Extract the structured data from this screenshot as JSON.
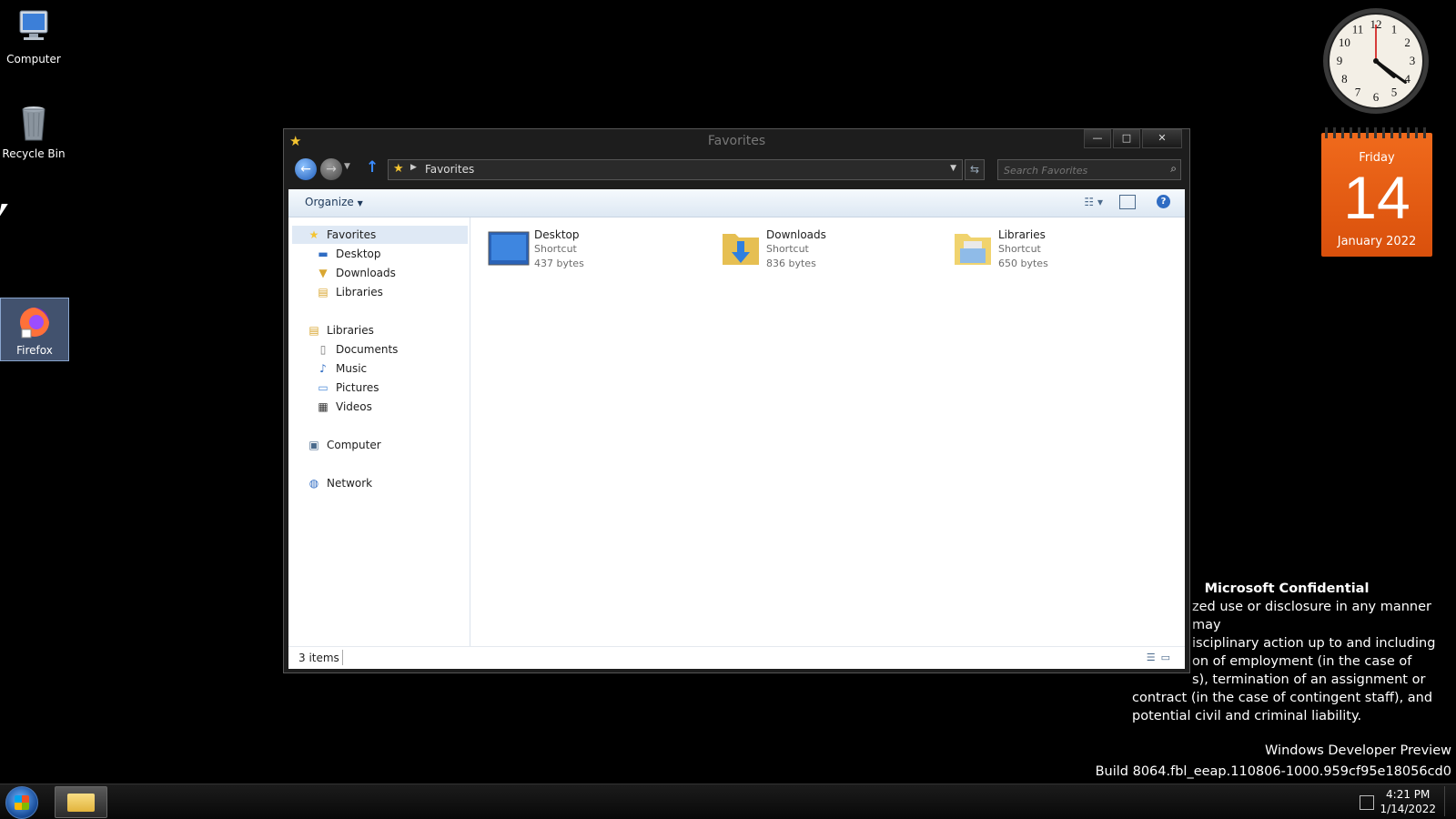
{
  "desktop": {
    "icons": [
      {
        "label": "Computer",
        "icon": "computer-icon"
      },
      {
        "label": "Recycle Bin",
        "icon": "recycle-bin-icon"
      },
      {
        "label": "Firefox",
        "icon": "firefox-icon"
      }
    ]
  },
  "clock_gadget": {
    "hour": 4,
    "minute": 21,
    "numerals": [
      "12",
      "1",
      "2",
      "3",
      "4",
      "5",
      "6",
      "7",
      "8",
      "9",
      "10",
      "11"
    ]
  },
  "calendar_gadget": {
    "weekday": "Friday",
    "day": "14",
    "month_year": "January 2022"
  },
  "confidential": {
    "title": "Microsoft Confidential",
    "lines": [
      "zed use or disclosure in any manner may",
      "isciplinary action up to and including",
      "on of employment (in the case of",
      "s), termination of an assignment or",
      "contract (in the case of contingent staff), and",
      "potential civil and criminal liability."
    ]
  },
  "watermark": {
    "line1": "Windows Developer Preview",
    "line2": "Build 8064.fbl_eeap.110806-1000.959cf95e18056cd0"
  },
  "window": {
    "title": "Favorites",
    "controls": {
      "minimize": "—",
      "maximize": "□",
      "close": "✕"
    },
    "address": {
      "crumb": "Favorites"
    },
    "search": {
      "placeholder": "Search Favorites"
    },
    "toolbar": {
      "organize": "Organize"
    },
    "nav_pane": {
      "favorites": {
        "label": "Favorites",
        "children": [
          "Desktop",
          "Downloads",
          "Libraries"
        ]
      },
      "libraries": {
        "label": "Libraries",
        "children": [
          "Documents",
          "Music",
          "Pictures",
          "Videos"
        ]
      },
      "computer": "Computer",
      "network": "Network"
    },
    "items": [
      {
        "name": "Desktop",
        "type": "Shortcut",
        "size": "437 bytes",
        "icon": "desktop-shortcut-icon"
      },
      {
        "name": "Downloads",
        "type": "Shortcut",
        "size": "836 bytes",
        "icon": "downloads-folder-icon"
      },
      {
        "name": "Libraries",
        "type": "Shortcut",
        "size": "650 bytes",
        "icon": "libraries-folder-icon"
      }
    ],
    "status": {
      "count": "3 items"
    }
  },
  "taskbar": {
    "time": "4:21 PM",
    "date": "1/14/2022"
  },
  "colors": {
    "calendar_orange": "#e8601a",
    "accent_blue": "#1e5bb8",
    "star_gold": "#f4c430"
  }
}
